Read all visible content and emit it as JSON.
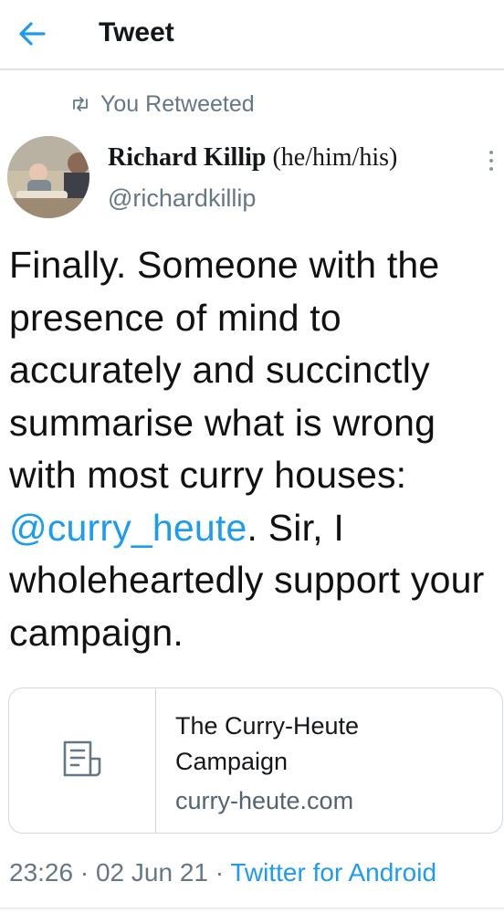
{
  "header": {
    "title": "Tweet"
  },
  "retweet": {
    "label": "You Retweeted"
  },
  "author": {
    "name": "Richard Killip",
    "pronouns": " (he/him/his)",
    "handle": "@richardkillip"
  },
  "tweet": {
    "text_before": "Finally. Someone with the presence of mind to accurately and succinctly summarise what is wrong with most curry houses: ",
    "mention": "@curry_heute",
    "text_after": ". Sir, I wholeheartedly support your campaign."
  },
  "card": {
    "title": "The Curry-Heute Campaign",
    "domain": "curry-heute.com",
    "icon": "document-icon"
  },
  "meta": {
    "time": "23:26",
    "sep1": " · ",
    "date": "02 Jun 21",
    "sep2": " · ",
    "source": "Twitter for Android"
  },
  "colors": {
    "link": "#1d9bf0",
    "secondary": "#657786",
    "border": "#cfd9de"
  }
}
